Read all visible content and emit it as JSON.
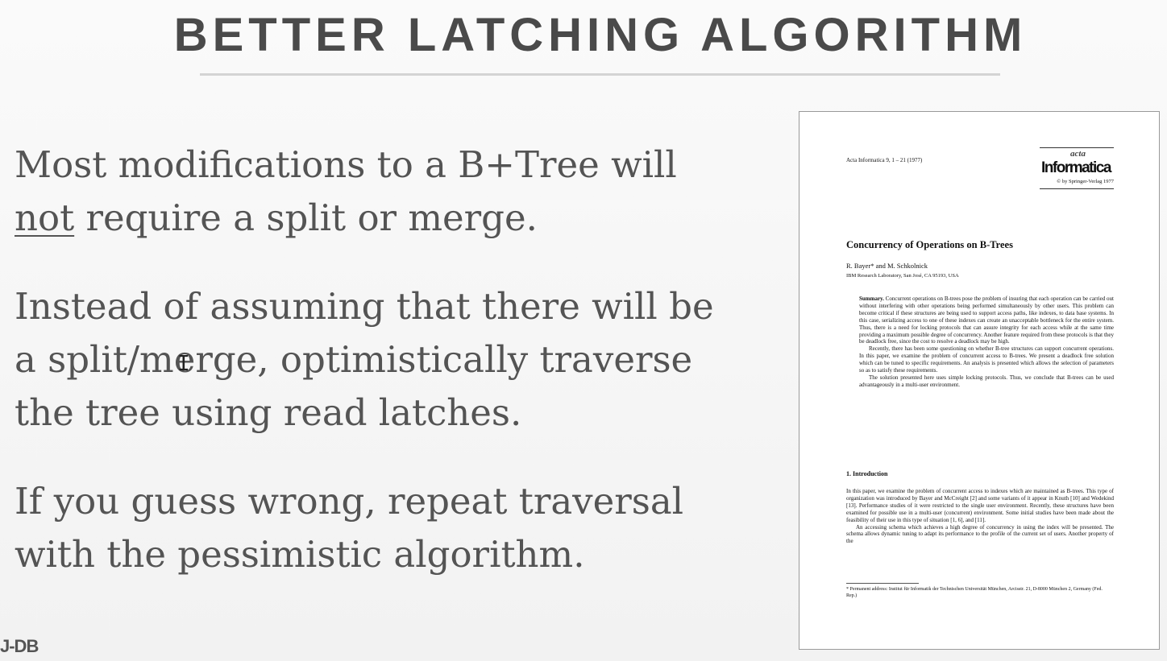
{
  "slide": {
    "title": "BETTER LATCHING ALGORITHM",
    "paragraph1_part1": "Most modifications to a B+Tree will",
    "paragraph1_underlined": "not",
    "paragraph1_part2": " require a split or merge.",
    "paragraph2": "Instead of assuming that there will be a split/merge, optimistically traverse the tree using read latches.",
    "paragraph3": "If you guess wrong, repeat traversal with the pessimistic algorithm.",
    "footer_logo": "J-DB"
  },
  "paper": {
    "journal": "Acta Informatica 9, 1 – 21 (1977)",
    "logo_small": "acta",
    "logo_main": "Informatica",
    "copyright": "© by Springer-Verlag 1977",
    "title": "Concurrency of Operations on B-Trees",
    "authors": "R. Bayer* and M. Schkolnick",
    "affiliation": "IBM Research Laboratory, San José, CA 95193, USA",
    "summary_label": "Summary.",
    "summary_p1": " Concurrent operations on B-trees pose the problem of insuring that each operation can be carried out without interfering with other operations being performed simultaneously by other users. This problem can become critical if these structures are being used to support access paths, like indexes, to data base systems. In this case, serializing access to one of these indexes can create an unacceptable bottleneck for the entire system. Thus, there is a need for locking protocols that can assure integrity for each access while at the same time providing a maximum possible degree of concurrency. Another feature required from these protocols is that they be deadlock free, since the cost to resolve a deadlock may be high.",
    "summary_p2": "Recently, there has been some questioning on whether B-tree structures can support concurrent operations. In this paper, we examine the problem of concurrent access to B-trees. We present a deadlock free solution which can be tuned to specific requirements. An analysis is presented which allows the selection of parameters so as to satisfy these requirements.",
    "summary_p3": "The solution presented here uses simple locking protocols. Thus, we conclude that B-trees can be used advantageously in a multi-user environment.",
    "section_heading": "1. Introduction",
    "intro_p1": "In this paper, we examine the problem of concurrent access to indexes which are maintained as B-trees. This type of organization was introduced by Bayer and McCreight [2] and some variants of it appear in Knuth [10] and Wedekind [13]. Performance studies of it were restricted to the single user environment. Recently, these structures have been examined for possible use in a multi-user (concurrent) environment. Some initial studies have been made about the feasibility of their use in this type of situation [1, 6], and [11].",
    "intro_p2": "An accessing schema which achieves a high degree of concurrency in using the index will be presented. The schema allows dynamic tuning to adapt its performance to the profile of the current set of users. Another property of the",
    "footnote": "* Permanent address: Institut für Informatik der Technischen Universität München, Arcisstr. 21, D-8000 München 2, Germany (Fed. Rep.)"
  }
}
